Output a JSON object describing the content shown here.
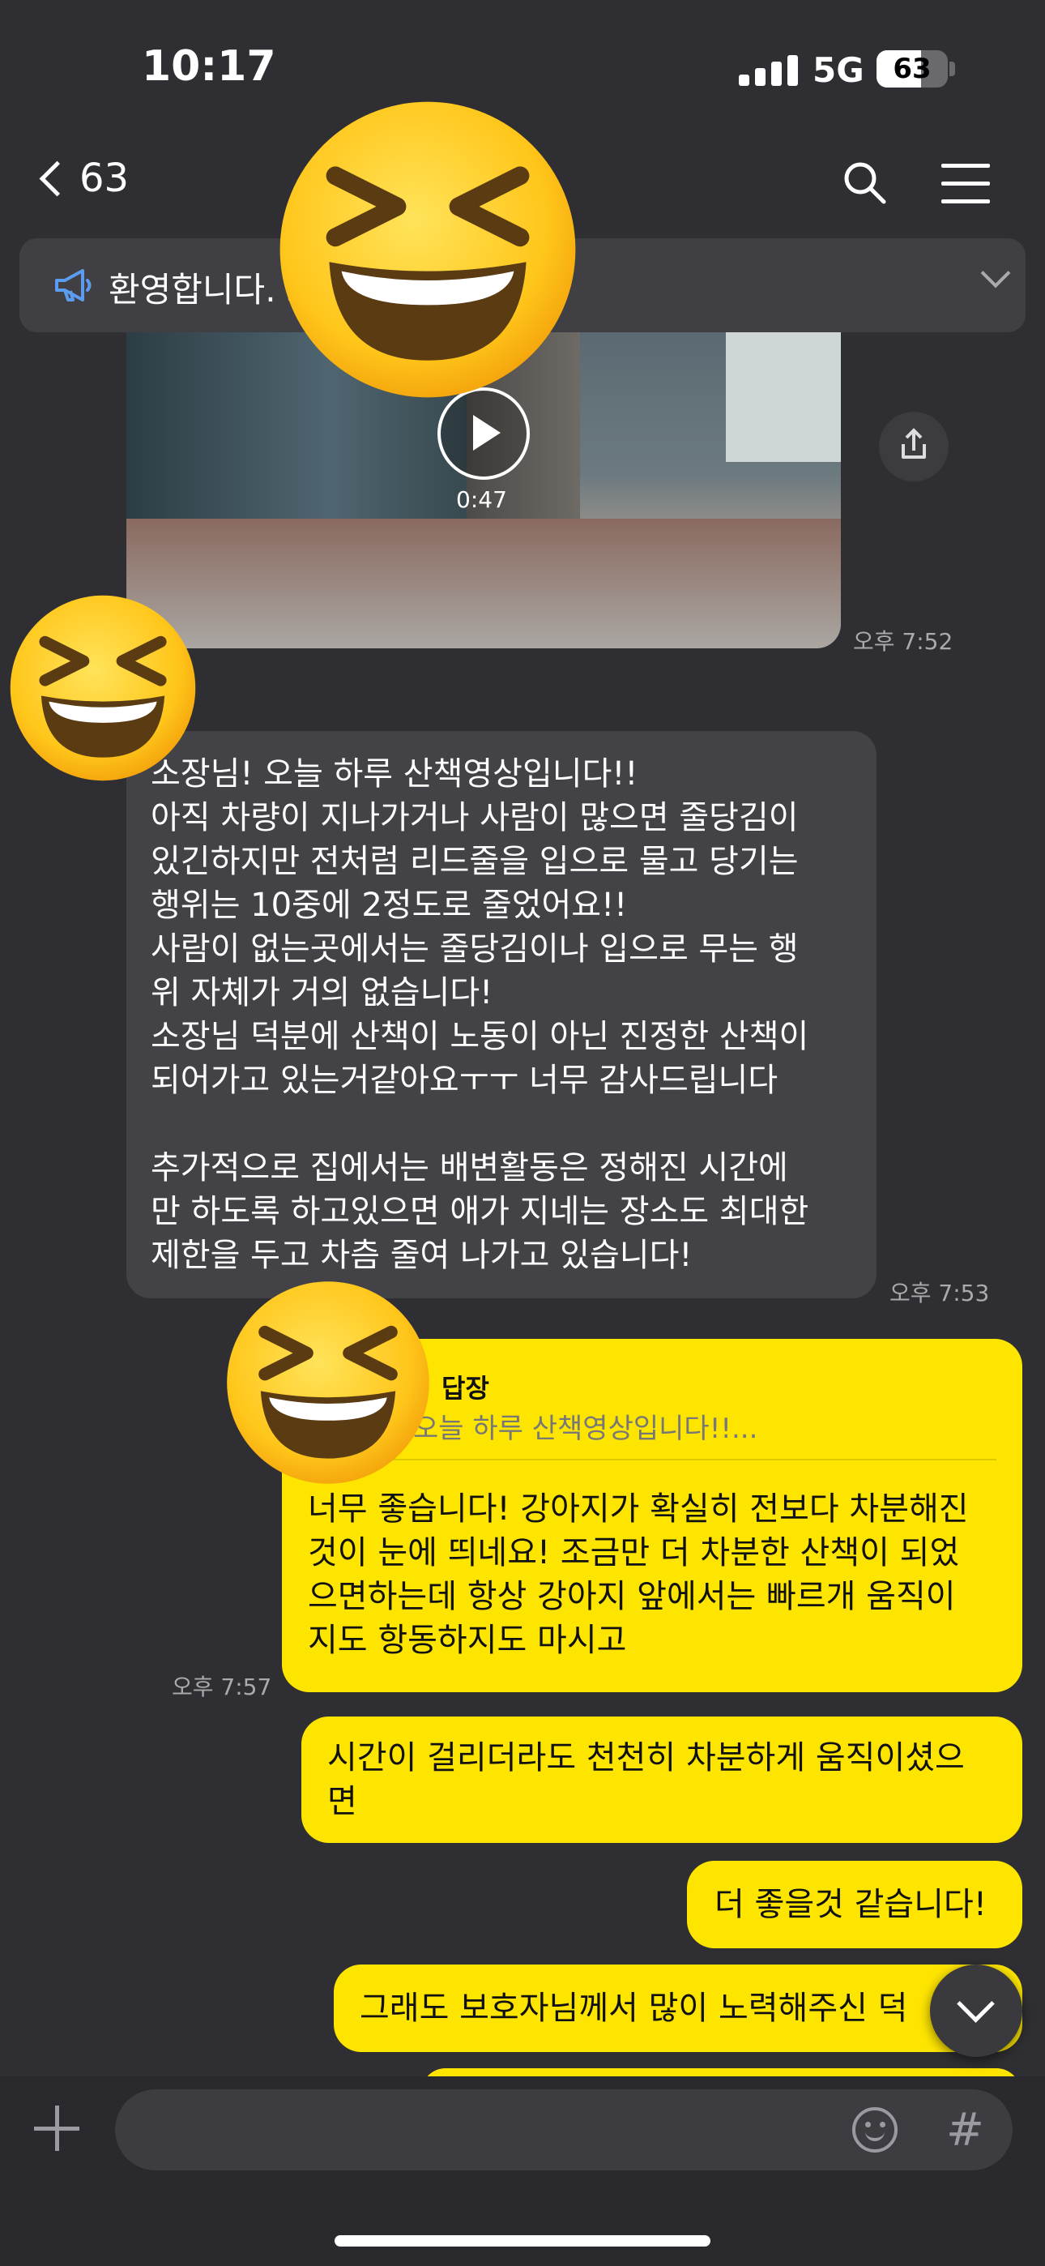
{
  "status": {
    "time": "10:17",
    "network": "5G",
    "battery": "63",
    "battery_level": 0.63
  },
  "nav": {
    "back_count": "63",
    "title": ""
  },
  "notice": {
    "text": "환영합니다.                    오픈채팅방입니다."
  },
  "video": {
    "duration": "0:47",
    "timestamp": "오후 7:52"
  },
  "messages": [
    {
      "side": "left",
      "text": "소장님! 오늘 하루 산책영상입니다!!\n아직 차량이 지나가거나 사람이 많으면 줄당김이\n있긴하지만 전처럼 리드줄을 입으로 물고 당기는\n행위는 10중에 2정도로 줄었어요!!\n사람이 없는곳에서는 줄당김이나 입으로 무는 행\n위 자체가 거의 없습니다!\n소장님 덕분에 산책이 노동이 아닌 진정한 산책이\n되어가고 있는거같아요ㅜㅜ 너무 감사드립니다\n\n추가적으로 집에서는 배변활동은 정해진 시간에\n만 하도록 하고있으면 애가 지네는 장소도 최대한\n제한을 두고 차츰 줄여 나가고 있습니다!",
      "timestamp": "오후 7:53"
    },
    {
      "side": "right",
      "reply_title": "답장",
      "reply_quote": "오늘 하루 산책영상입니다!!...",
      "text": "너무 좋습니다! 강아지가 확실히 전보다 차분해진\n것이 눈에 띄네요! 조금만 더 차분한 산책이 되었\n으면하는데 항상 강아지 앞에서는 빠르개 움직이\n지도 항동하지도 마시고",
      "timestamp": "오후 7:57"
    },
    {
      "side": "right",
      "text": "시간이 걸리더라도 천천히 차분하게 움직이셨으\n면"
    },
    {
      "side": "right",
      "text": "더 좋을것 같습니다!"
    },
    {
      "side": "right",
      "text": "그래도 보호자님께서 많이 노력해주신 덕"
    }
  ],
  "icons": {
    "back": "chevron-left-icon",
    "search": "search-icon",
    "menu": "menu-icon",
    "notice": "megaphone-icon",
    "play": "play-icon",
    "share": "share-icon",
    "scroll": "chevron-down-icon",
    "add": "plus-icon",
    "emoji": "emoji-icon",
    "hashtag": "hashtag-icon",
    "sticker": "grinning-squinting-face"
  },
  "input": {
    "placeholder": ""
  },
  "colors": {
    "background": "#2f2f33",
    "my_bubble": "#fee500",
    "other_bubble": "#424247",
    "notice_bar": "#3f3f44"
  }
}
